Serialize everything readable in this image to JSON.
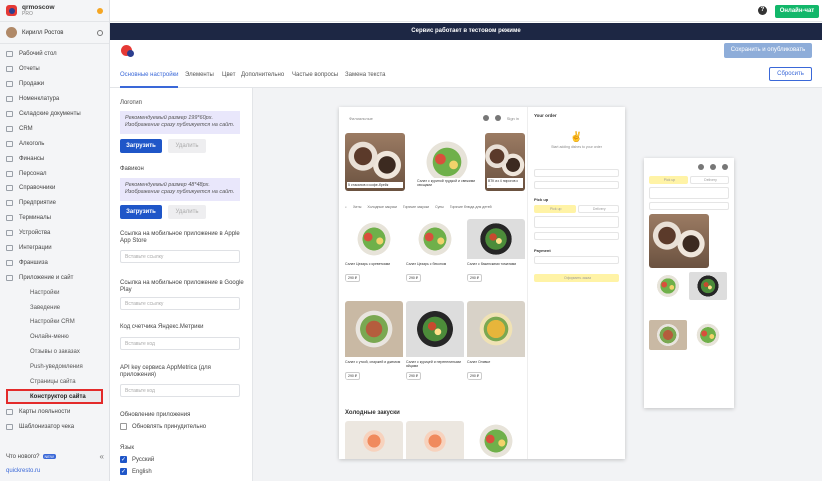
{
  "brand": {
    "name": "qrmoscow",
    "plan": "PRO"
  },
  "user": {
    "name": "Кирилл Ростов"
  },
  "sidebar": {
    "items": [
      {
        "label": "Рабочий стол"
      },
      {
        "label": "Отчеты"
      },
      {
        "label": "Продажи"
      },
      {
        "label": "Номенклатура"
      },
      {
        "label": "Складские документы"
      },
      {
        "label": "CRM"
      },
      {
        "label": "Алкоголь"
      },
      {
        "label": "Финансы"
      },
      {
        "label": "Персонал"
      },
      {
        "label": "Справочники"
      },
      {
        "label": "Предприятие"
      },
      {
        "label": "Терминалы"
      },
      {
        "label": "Устройства"
      },
      {
        "label": "Интеграции"
      },
      {
        "label": "Франшиза"
      },
      {
        "label": "Приложение и сайт"
      }
    ],
    "subitems": [
      {
        "label": "Настройки"
      },
      {
        "label": "Заведение"
      },
      {
        "label": "Настройки CRM"
      },
      {
        "label": "Онлайн-меню"
      },
      {
        "label": "Отзывы о заказах"
      },
      {
        "label": "Push-уведомления"
      },
      {
        "label": "Страницы сайта"
      },
      {
        "label": "Конструктор сайта"
      }
    ],
    "after": [
      {
        "label": "Карты лояльности"
      },
      {
        "label": "Шаблонизатор чека"
      }
    ],
    "whats_new": "Что нового?",
    "new_badge": "NEW",
    "link": "quickresto.ru"
  },
  "topbar": {
    "help": "?",
    "chat": "Онлайн-чат"
  },
  "banner": "Сервис работает в тестовом режиме",
  "editor": {
    "save": "Сохранить и опубликовать",
    "reset": "Сбросить"
  },
  "tabs": [
    "Основные настройки",
    "Элементы",
    "Цвет",
    "Дополнительно",
    "Частые вопросы",
    "Замена текста"
  ],
  "form": {
    "logo_label": "Логотип",
    "logo_note": "Рекомендуемый размер 199*60px. Изображение сразу публикуется на сайт.",
    "upload": "Загрузить",
    "delete": "Удалить",
    "favicon_label": "Фавикон",
    "favicon_note": "Рекомендуемый размер 48*48px. Изображение сразу публикуется на сайт.",
    "appstore_label": "Ссылка на мобильное приложение в Apple App Store",
    "gplay_label": "Ссылка на мобильное приложение в Google Play",
    "link_placeholder": "Вставьте ссылку",
    "yametrika_label": "Код счетчика Яндекс.Метрики",
    "code_placeholder": "Вставьте код",
    "appmetrica_label": "API key сервиса AppMetrica (для приложения)",
    "update_label": "Обновление приложения",
    "force_update": "Обновлять принудительно",
    "lang_label": "Язык",
    "lang_ru": "Русский",
    "lang_en": "English",
    "check_mark": "✓"
  },
  "preview": {
    "desk_title": "Филиальные",
    "signin": "Sign in",
    "heroes": [
      "5 стаканов и кофе-брейк",
      "Салат с куриной грудкой и свежими овощами",
      "ВТК из 4 пирогов с ..."
    ],
    "categories": [
      "Хиты",
      "Холодные закуски",
      "Горячие закуски",
      "Супы",
      "Горячие блюда для детей"
    ],
    "products": [
      {
        "name": "Салат Цезарь с креветками",
        "price": "290 ₽"
      },
      {
        "name": "Салат Цезарь с беконом",
        "price": "290 ₽"
      },
      {
        "name": "Салат с бакинскими томатами",
        "price": "290 ₽"
      },
      {
        "name": "Салат с уткой, спаржей и джемом",
        "price": "290 ₽"
      },
      {
        "name": "Салат с курицей и перепелиными яйцами",
        "price": "290 ₽"
      },
      {
        "name": "Салат Оливье",
        "price": "290 ₽"
      }
    ],
    "section": "Холодные закуски",
    "order_title": "Your order",
    "order_empty": "Start adding dishes to your order",
    "pickup": "Pick up",
    "pickup_btn": "Pick up",
    "delivery": "Delivery",
    "payment": "Payment",
    "order_btn": "Оформить заказ"
  }
}
